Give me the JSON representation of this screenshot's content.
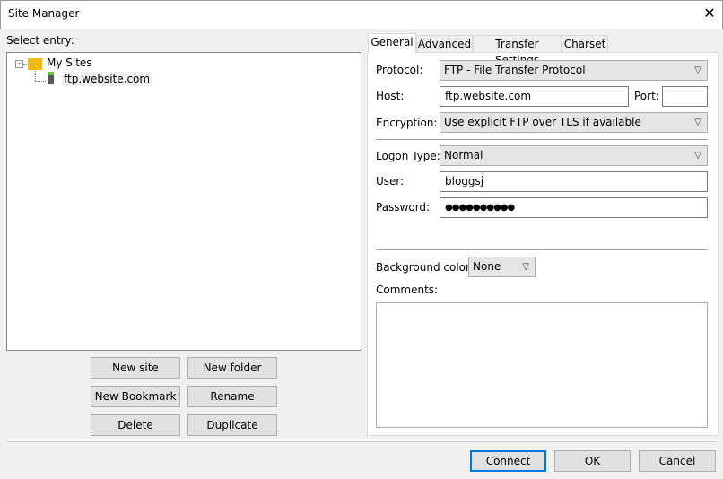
{
  "window": {
    "title": "Site Manager",
    "close": "✕"
  },
  "left": {
    "select_entry_label": "Select entry:",
    "tree": {
      "root": "My Sites",
      "child": "ftp.website.com"
    },
    "buttons": {
      "new_site": "New site",
      "new_folder": "New folder",
      "new_bookmark": "New Bookmark",
      "rename": "Rename",
      "delete": "Delete",
      "duplicate": "Duplicate"
    }
  },
  "tabs": [
    "General",
    "Advanced",
    "Transfer Settings",
    "Charset"
  ],
  "general": {
    "protocol_label": "Protocol:",
    "protocol_value": "FTP - File Transfer Protocol",
    "host_label": "Host:",
    "host_value": "ftp.website.com",
    "port_label": "Port:",
    "port_value": "",
    "encryption_label": "Encryption:",
    "encryption_value": "Use explicit FTP over TLS if available",
    "logon_label": "Logon Type:",
    "logon_value": "Normal",
    "user_label": "User:",
    "user_value": "bloggsj",
    "password_label": "Password:",
    "password_value": "●●●●●●●●●●",
    "bgcolor_label": "Background color:",
    "bgcolor_value": "None",
    "comments_label": "Comments:",
    "comments_value": ""
  },
  "footer": {
    "connect": "Connect",
    "ok": "OK",
    "cancel": "Cancel"
  }
}
